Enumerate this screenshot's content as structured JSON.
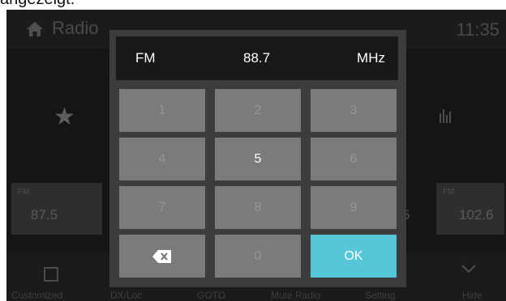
{
  "caption": "angezeigt.",
  "app": {
    "title": "Radio",
    "clock": "11:35"
  },
  "icons": {
    "home": "home-icon",
    "favorite": "star-icon",
    "equalizer": "equalizer-icon",
    "edit": "edit-icon",
    "hide": "chevron-down-icon",
    "backspace": "backspace-icon"
  },
  "presets": {
    "left": {
      "band": "FM",
      "freq": "87.5"
    },
    "partial": "5",
    "right": {
      "band": "FM",
      "freq": "102.6"
    }
  },
  "bottom_bar": [
    "Customized",
    "DX/Loc",
    "GOTO",
    "Mute Radio",
    "Setting",
    "Hide"
  ],
  "keypad": {
    "band": "FM",
    "frequency": "88.7",
    "unit": "MHz",
    "keys": [
      "1",
      "2",
      "3",
      "4",
      "5",
      "6",
      "7",
      "8",
      "9",
      "",
      "0",
      "OK"
    ]
  },
  "colors": {
    "ok_button": "#55c7d8",
    "key": "#7b7b7b",
    "dialog": "#3c3c3c"
  }
}
